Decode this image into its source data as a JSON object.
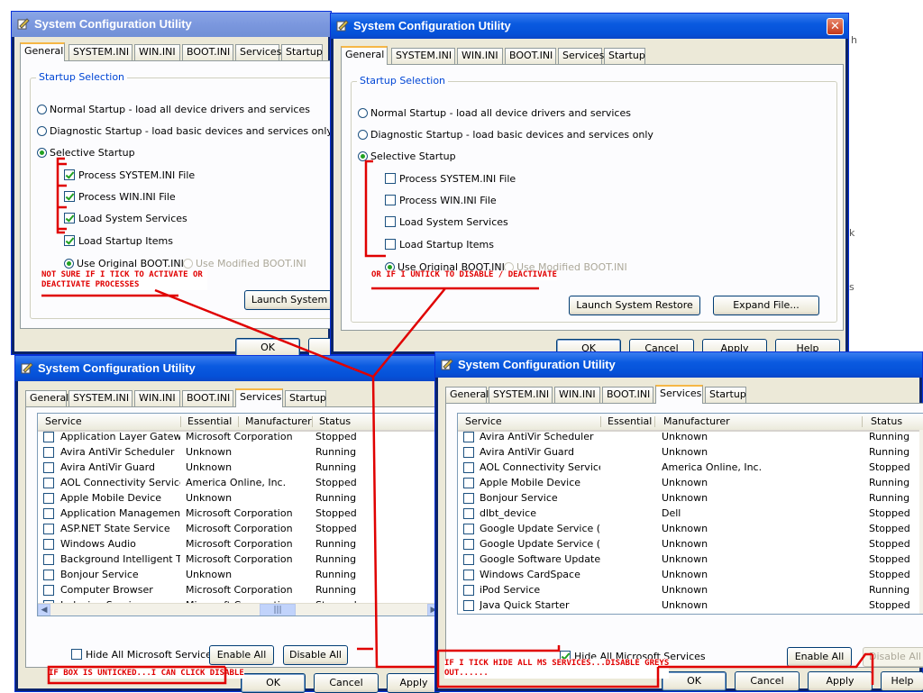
{
  "background_fragments": [
    "h",
    "k",
    "s"
  ],
  "accent_colors": {
    "annotation_red": "#e00000",
    "title_active": "#0a5ae0",
    "group_label": "#0046d5"
  },
  "win1": {
    "title": "System Configuration Utility",
    "tabs": [
      "General",
      "SYSTEM.INI",
      "WIN.INI",
      "BOOT.INI",
      "Services",
      "Startup"
    ],
    "group_label": "Startup Selection",
    "radios": [
      "Normal Startup - load all device drivers and services",
      "Diagnostic Startup - load basic devices and services only",
      "Selective Startup"
    ],
    "checks": [
      "Process SYSTEM.INI File",
      "Process WIN.INI File",
      "Load System Services",
      "Load Startup Items"
    ],
    "boot_original": "Use Original BOOT.INI",
    "boot_modified": "Use Modified BOOT.INI",
    "launch_button": "Launch System",
    "ok_button": "OK"
  },
  "win2": {
    "title": "System Configuration Utility",
    "tabs": [
      "General",
      "SYSTEM.INI",
      "WIN.INI",
      "BOOT.INI",
      "Services",
      "Startup"
    ],
    "group_label": "Startup Selection",
    "radios": [
      "Normal Startup - load all device drivers and services",
      "Diagnostic Startup - load basic devices and services only",
      "Selective Startup"
    ],
    "checks": [
      "Process SYSTEM.INI File",
      "Process WIN.INI File",
      "Load System Services",
      "Load Startup Items"
    ],
    "boot_original": "Use Original BOOT.INI",
    "boot_modified": "Use Modified BOOT.INI",
    "launch_button": "Launch System Restore",
    "expand_button": "Expand File...",
    "ok_button": "OK",
    "cancel_button": "Cancel",
    "apply_button": "Apply",
    "help_button": "Help"
  },
  "win3": {
    "title": "System Configuration Utility",
    "tabs": [
      "General",
      "SYSTEM.INI",
      "WIN.INI",
      "BOOT.INI",
      "Services",
      "Startup"
    ],
    "columns": [
      "Service",
      "Essential",
      "Manufacturer",
      "Status"
    ],
    "rows": [
      [
        "Application Layer Gatew...",
        "",
        "Microsoft Corporation",
        "Stopped"
      ],
      [
        "Avira AntiVir Scheduler",
        "",
        "Unknown",
        "Running"
      ],
      [
        "Avira AntiVir Guard",
        "",
        "Unknown",
        "Running"
      ],
      [
        "AOL Connectivity Service",
        "",
        "America Online, Inc.",
        "Stopped"
      ],
      [
        "Apple Mobile Device",
        "",
        "Unknown",
        "Running"
      ],
      [
        "Application Management",
        "",
        "Microsoft Corporation",
        "Stopped"
      ],
      [
        "ASP.NET State Service",
        "",
        "Microsoft Corporation",
        "Stopped"
      ],
      [
        "Windows Audio",
        "",
        "Microsoft Corporation",
        "Running"
      ],
      [
        "Background Intelligent T...",
        "",
        "Microsoft Corporation",
        "Running"
      ],
      [
        "Bonjour Service",
        "",
        "Unknown",
        "Running"
      ],
      [
        "Computer Browser",
        "",
        "Microsoft Corporation",
        "Running"
      ],
      [
        "Indexing Service",
        "",
        "Microsoft Corporation",
        "Stopped"
      ]
    ],
    "hide_ms": "Hide All Microsoft Services",
    "enable_all": "Enable All",
    "disable_all": "Disable All",
    "ok_button": "OK",
    "cancel_button": "Cancel",
    "apply_button": "Apply"
  },
  "win4": {
    "title": "System Configuration Utility",
    "tabs": [
      "General",
      "SYSTEM.INI",
      "WIN.INI",
      "BOOT.INI",
      "Services",
      "Startup"
    ],
    "columns": [
      "Service",
      "Essential",
      "Manufacturer",
      "Status"
    ],
    "rows": [
      [
        "Avira AntiVir Scheduler",
        "",
        "Unknown",
        "Running"
      ],
      [
        "Avira AntiVir Guard",
        "",
        "Unknown",
        "Running"
      ],
      [
        "AOL Connectivity Service",
        "",
        "America Online, Inc.",
        "Stopped"
      ],
      [
        "Apple Mobile Device",
        "",
        "Unknown",
        "Running"
      ],
      [
        "Bonjour Service",
        "",
        "Unknown",
        "Running"
      ],
      [
        "dlbt_device",
        "",
        "Dell",
        "Stopped"
      ],
      [
        "Google Update Service (...",
        "",
        "Unknown",
        "Stopped"
      ],
      [
        "Google Update Service (...",
        "",
        "Unknown",
        "Stopped"
      ],
      [
        "Google Software Updater",
        "",
        "Unknown",
        "Stopped"
      ],
      [
        "Windows CardSpace",
        "",
        "Unknown",
        "Stopped"
      ],
      [
        "iPod Service",
        "",
        "Unknown",
        "Running"
      ],
      [
        "Java Quick Starter",
        "",
        "Unknown",
        "Stopped"
      ]
    ],
    "hide_ms": "Hide All Microsoft Services",
    "enable_all": "Enable All",
    "disable_all": "Disable All",
    "ok_button": "OK",
    "cancel_button": "Cancel",
    "apply_button": "Apply",
    "help_button": "Help"
  },
  "annotations": {
    "a1": "NOT SURE IF I TICK TO ACTIVATE OR\nDEACTIVATE PROCESSES",
    "a2": "OR IF I UNTICK TO DISABLE / DEACTIVATE",
    "a3": "IF BOX IS UNTICKED...I CAN CLICK DISABLE",
    "a4": "IF I TICK HIDE ALL MS SERVICES...DISABLE GREYS\nOUT......"
  }
}
